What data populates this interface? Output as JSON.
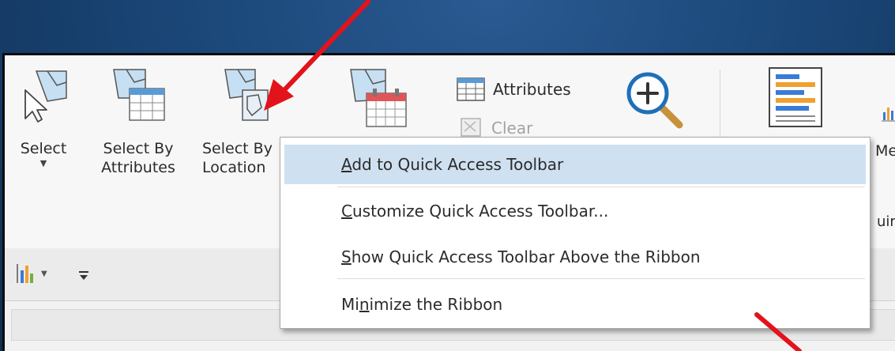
{
  "ribbon": {
    "select_label": "Select",
    "select_by_attributes_line1": "Select By",
    "select_by_attributes_line2": "Attributes",
    "select_by_location_line1": "Select By",
    "select_by_location_line2": "Location",
    "attributes_label": "Attributes",
    "clear_label": "Clear",
    "partial_right_label": "Me",
    "partial_right_label_2": "uir"
  },
  "context_menu": {
    "items": [
      {
        "pre": "",
        "mnemonic": "A",
        "post": "dd to Quick Access Toolbar",
        "state": "highlighted"
      },
      {
        "pre": "",
        "mnemonic": "C",
        "post": "ustomize Quick Access Toolbar...",
        "state": "normal"
      },
      {
        "pre": "",
        "mnemonic": "S",
        "post": "how Quick Access Toolbar Above the Ribbon",
        "state": "normal"
      },
      {
        "pre": "Mi",
        "mnemonic": "n",
        "post": "imize the Ribbon",
        "state": "normal"
      }
    ]
  },
  "colors": {
    "background": "#1a4677",
    "menu_highlight": "#cfe1f1",
    "arrow": "#e3131b",
    "icon_blue": "#c6dff2"
  },
  "icons": [
    "select-cursor-icon",
    "select-by-attributes-icon",
    "select-by-location-icon",
    "calendar-select-icon",
    "attributes-table-icon",
    "clear-icon",
    "zoom-in-icon",
    "layout-list-icon",
    "bar-chart-icon",
    "qat-customize-icon"
  ]
}
